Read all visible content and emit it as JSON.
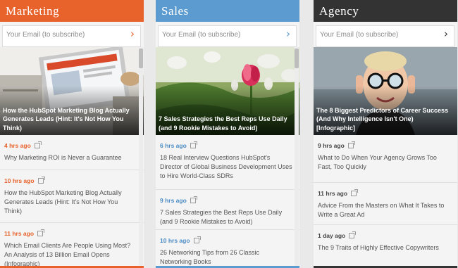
{
  "columns": [
    {
      "title": "Marketing",
      "accent": "#e8622b",
      "subscribe_placeholder": "Your Email (to subscribe)",
      "subscribe_icon": "chevron-right-icon",
      "hero_title": "How the HubSpot Marketing Blog Actually Generates Leads (Hint: It's Not How You Think)",
      "posts": [
        {
          "time": "4 hrs ago",
          "title": "Why Marketing ROI is Never a Guarantee"
        },
        {
          "time": "10 hrs ago",
          "title": "How the HubSpot Marketing Blog Actually Generates Leads (Hint: It's Not How You Think)"
        },
        {
          "time": "11 hrs ago",
          "title": "Which Email Clients Are People Using Most? An Analysis of 13 Billion Email Opens (Infographic)"
        }
      ]
    },
    {
      "title": "Sales",
      "accent": "#5b9bd0",
      "subscribe_placeholder": "Your Email (to subscribe)",
      "subscribe_icon": "chevron-right-icon",
      "hero_title": "7 Sales Strategies the Best Reps Use Daily (and 9 Rookie Mistakes to Avoid)",
      "posts": [
        {
          "time": "6 hrs ago",
          "title": "18 Real Interview Questions HubSpot's Director of Global Business Development Uses to Hire World-Class SDRs"
        },
        {
          "time": "9 hrs ago",
          "title": "7 Sales Strategies the Best Reps Use Daily (and 9 Rookie Mistakes to Avoid)"
        },
        {
          "time": "10 hrs ago",
          "title": "26 Networking Tips from 26 Classic Networking Books"
        }
      ]
    },
    {
      "title": "Agency",
      "accent": "#333333",
      "subscribe_placeholder": "Your Email (to subscribe)",
      "subscribe_icon": "chevron-right-icon",
      "hero_title": "The 8 Biggest Predictors of Career Success (And Why Intelligence Isn't One) [Infographic]",
      "posts": [
        {
          "time": "9 hrs ago",
          "title": "What to Do When Your Agency Grows Too Fast, Too Quickly"
        },
        {
          "time": "11 hrs ago",
          "title": "Advice From the Masters on What It Takes to Write a Great Ad"
        },
        {
          "time": "1 day ago",
          "title": "The 9 Traits of Highly Effective Copywriters"
        }
      ]
    }
  ]
}
